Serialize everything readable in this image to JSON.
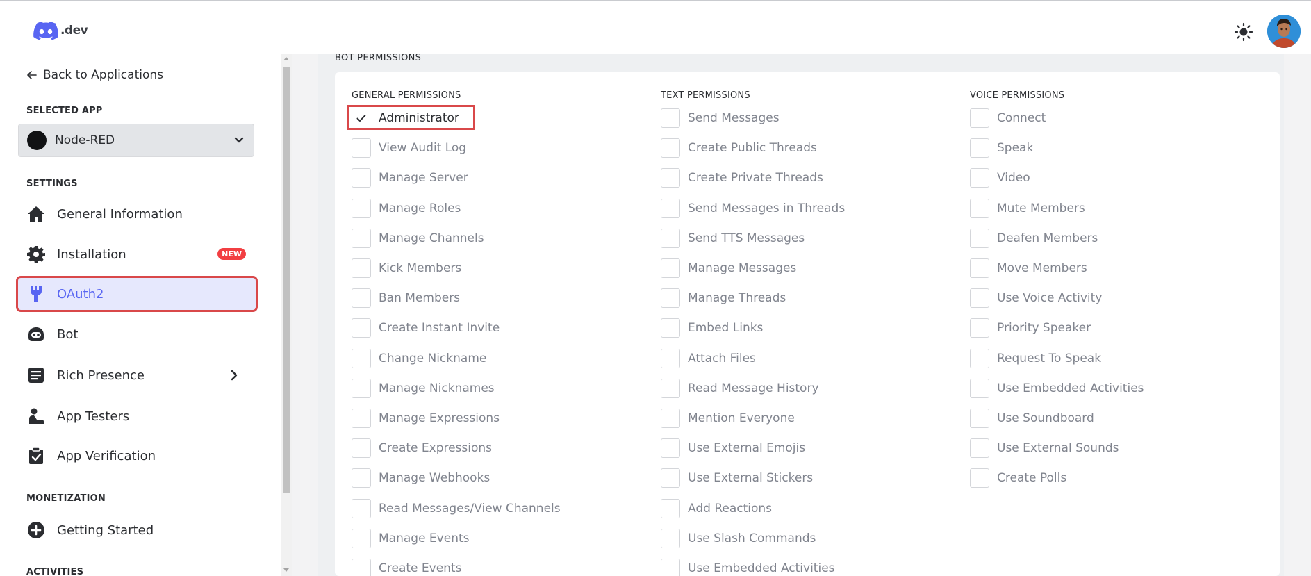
{
  "header": {
    "logo_text": ".dev",
    "theme_icon": "sun-icon",
    "avatar_icon": "user-avatar"
  },
  "sidebar": {
    "back_label": "Back to Applications",
    "selected_app_heading": "SELECTED APP",
    "selected_app_name": "Node-RED",
    "settings_heading": "SETTINGS",
    "items": [
      {
        "label": "General Information",
        "icon": "home-icon"
      },
      {
        "label": "Installation",
        "icon": "gear-icon",
        "badge": "NEW"
      },
      {
        "label": "OAuth2",
        "icon": "wrench-icon",
        "active": true
      },
      {
        "label": "Bot",
        "icon": "bot-icon"
      },
      {
        "label": "Rich Presence",
        "icon": "document-icon"
      },
      {
        "label": "App Testers",
        "icon": "person-icon"
      },
      {
        "label": "App Verification",
        "icon": "clipboard-check-icon"
      }
    ],
    "monetization_heading": "MONETIZATION",
    "getting_started_label": "Getting Started",
    "activities_heading": "ACTIVITIES"
  },
  "main": {
    "bot_permissions_title": "BOT PERMISSIONS",
    "columns": [
      {
        "heading": "GENERAL PERMISSIONS",
        "items": [
          "Administrator",
          "View Audit Log",
          "Manage Server",
          "Manage Roles",
          "Manage Channels",
          "Kick Members",
          "Ban Members",
          "Create Instant Invite",
          "Change Nickname",
          "Manage Nicknames",
          "Manage Expressions",
          "Create Expressions",
          "Manage Webhooks",
          "Read Messages/View Channels",
          "Manage Events",
          "Create Events"
        ]
      },
      {
        "heading": "TEXT PERMISSIONS",
        "items": [
          "Send Messages",
          "Create Public Threads",
          "Create Private Threads",
          "Send Messages in Threads",
          "Send TTS Messages",
          "Manage Messages",
          "Manage Threads",
          "Embed Links",
          "Attach Files",
          "Read Message History",
          "Mention Everyone",
          "Use External Emojis",
          "Use External Stickers",
          "Add Reactions",
          "Use Slash Commands",
          "Use Embedded Activities"
        ]
      },
      {
        "heading": "VOICE PERMISSIONS",
        "items": [
          "Connect",
          "Speak",
          "Video",
          "Mute Members",
          "Deafen Members",
          "Move Members",
          "Use Voice Activity",
          "Priority Speaker",
          "Request To Speak",
          "Use Embedded Activities",
          "Use Soundboard",
          "Use External Sounds",
          "Create Polls"
        ]
      }
    ],
    "checked": [
      "Administrator"
    ]
  }
}
